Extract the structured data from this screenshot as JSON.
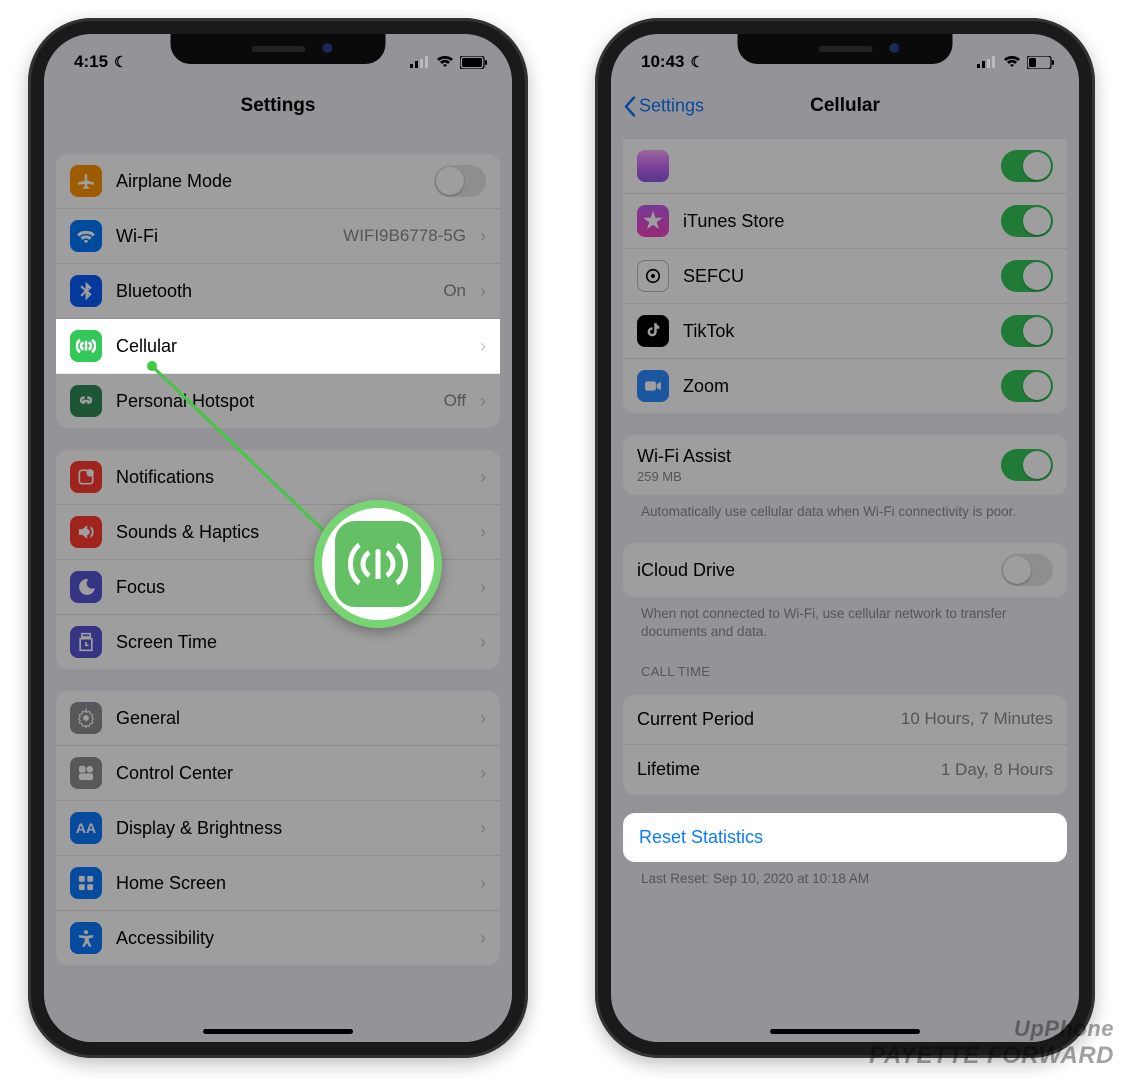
{
  "watermark": {
    "line1": "UpPhone",
    "line2": "PAYETTE FORWARD"
  },
  "phone_left": {
    "status": {
      "time": "4:15"
    },
    "nav": {
      "title": "Settings"
    },
    "group1": [
      {
        "icon": "airplane",
        "label": "Airplane Mode",
        "toggle": false
      },
      {
        "icon": "wifi",
        "label": "Wi-Fi",
        "value": "WIFI9B6778-5G",
        "chev": true
      },
      {
        "icon": "bluetooth",
        "label": "Bluetooth",
        "value": "On",
        "chev": true
      },
      {
        "icon": "cellular",
        "label": "Cellular",
        "chev": true,
        "highlight": true
      },
      {
        "icon": "hotspot",
        "label": "Personal Hotspot",
        "value": "Off",
        "chev": true
      }
    ],
    "group2": [
      {
        "icon": "notifications",
        "label": "Notifications",
        "chev": true
      },
      {
        "icon": "sounds",
        "label": "Sounds & Haptics",
        "chev": true
      },
      {
        "icon": "focus",
        "label": "Focus",
        "chev": true
      },
      {
        "icon": "screentime",
        "label": "Screen Time",
        "chev": true
      }
    ],
    "group3": [
      {
        "icon": "general",
        "label": "General",
        "chev": true
      },
      {
        "icon": "controlcenter",
        "label": "Control Center",
        "chev": true
      },
      {
        "icon": "display",
        "label": "Display & Brightness",
        "chev": true
      },
      {
        "icon": "homescreen",
        "label": "Home Screen",
        "chev": true
      },
      {
        "icon": "accessibility",
        "label": "Accessibility",
        "chev": true
      }
    ]
  },
  "phone_right": {
    "status": {
      "time": "10:43"
    },
    "nav": {
      "back": "Settings",
      "title": "Cellular"
    },
    "apps": [
      {
        "icon": "itunes",
        "label": "iTunes Store",
        "toggle": true
      },
      {
        "icon": "sefcu",
        "label": "SEFCU",
        "toggle": true
      },
      {
        "icon": "tiktok",
        "label": "TikTok",
        "toggle": true
      },
      {
        "icon": "zoom",
        "label": "Zoom",
        "toggle": true
      }
    ],
    "wifi_assist": {
      "label": "Wi-Fi Assist",
      "sub": "259 MB",
      "toggle": true,
      "note": "Automatically use cellular data when Wi-Fi connectivity is poor."
    },
    "icloud_drive": {
      "label": "iCloud Drive",
      "toggle": false,
      "note": "When not connected to Wi-Fi, use cellular network to transfer documents and data."
    },
    "call_time": {
      "header": "CALL TIME",
      "rows": [
        {
          "label": "Current Period",
          "value": "10 Hours, 7 Minutes"
        },
        {
          "label": "Lifetime",
          "value": "1 Day, 8 Hours"
        }
      ]
    },
    "reset": {
      "label": "Reset Statistics",
      "last_reset": "Last Reset: Sep 10, 2020 at 10:18 AM"
    }
  }
}
